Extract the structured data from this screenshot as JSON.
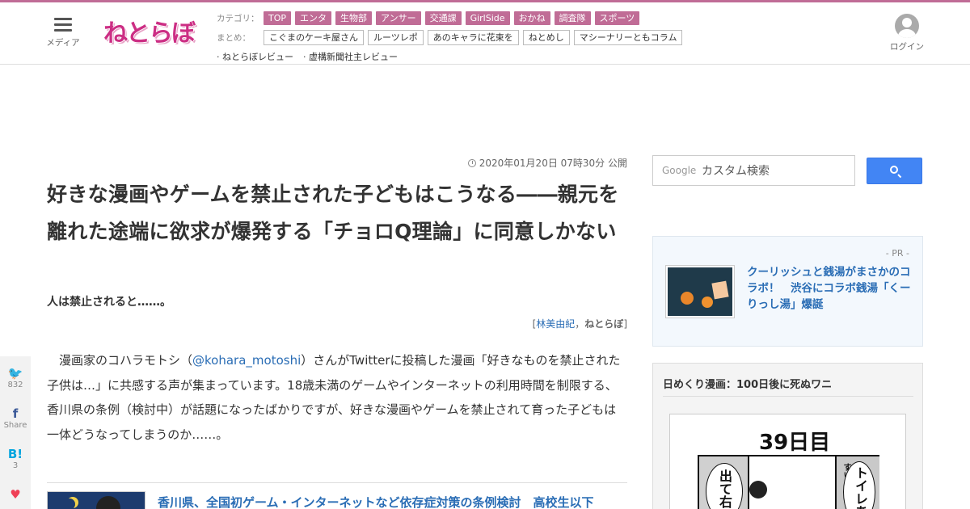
{
  "header": {
    "menu_label": "メディア",
    "logo_text": "ねとらぼ",
    "category_label": "カテゴリ：",
    "categories": [
      "TOP",
      "エンタ",
      "生物部",
      "アンサー",
      "交通課",
      "GirlSide",
      "おかね",
      "調査隊",
      "スポーツ"
    ],
    "matome_label": "まとめ：",
    "matome": [
      "こぐまのケーキ屋さん",
      "ルーツレポ",
      "あのキャラに花束を",
      "ねとめし",
      "マシーナリーともコラム"
    ],
    "reviews": [
      "· ねとらぼレビュー",
      "· 虚構新聞社主レビュー"
    ],
    "login_label": "ログイン",
    "accent_color": "#c06c96"
  },
  "article": {
    "date": "2020年01月20日 07時30分 公開",
    "title": "好きな漫画やゲームを禁止された子どもはこうなる――親元を離れた途端に欲求が爆発する「チョロQ理論」に同意しかない",
    "subtitle": "人は禁止されると……。",
    "byline_open": "[",
    "author": "林美由紀",
    "byline_sep": "，",
    "publisher": "ねとらぼ",
    "byline_close": "]",
    "body_prefix": "　漫画家のコハラモトシ（",
    "body_handle": "@kohara_motoshi",
    "body_rest": "）さんがTwitterに投稿した漫画「好きなものを禁止された子供は…」に共感する声が集まっています。18歳未満のゲームやインターネットの利用時間を制限する、香川県の条例（検討中）が話題になったばかりですが、好きな漫画やゲームを禁止されて育った子どもは一体どうなってしまうのか……。",
    "related_title": "香川県、全国初ゲーム・インターネットなど依存症対策の条例検討　高校生以下"
  },
  "share": [
    {
      "icon": "twitter-icon",
      "glyph": "🐦",
      "count": "832"
    },
    {
      "icon": "facebook-icon",
      "glyph": "f",
      "count": "Share"
    },
    {
      "icon": "hatena-icon",
      "glyph": "B!",
      "count": "3"
    },
    {
      "icon": "pocket-icon",
      "glyph": "♥",
      "count": ""
    }
  ],
  "sidebar": {
    "search_logo": "Google",
    "search_placeholder": "カスタム検索",
    "pr_label": "- PR -",
    "pr_title": "クーリッシュと銭湯がまさかのコラボ！　渋谷にコラボ銭湯「くーりっし湯」爆誕",
    "manga_title": "日めくり漫画：100日後に死ぬワニ",
    "manga_day": "39日目",
    "manga_text_left": "出て右",
    "manga_text_right": "トイレあ",
    "manga_text_small": "すいません"
  }
}
